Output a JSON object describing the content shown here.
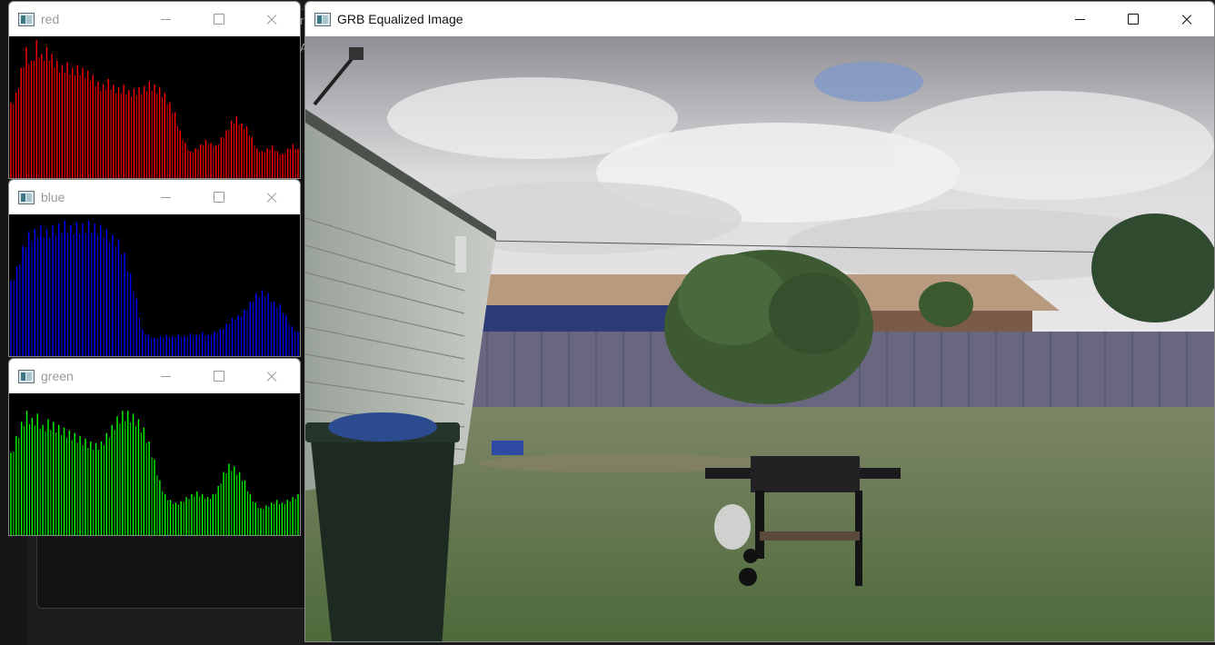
{
  "background": {
    "fragment_1": "r",
    "fragment_2": "A"
  },
  "windows": {
    "red": {
      "title": "red",
      "icon": "opencv-window-icon",
      "color": "#ff0000"
    },
    "blue": {
      "title": "blue",
      "icon": "opencv-window-icon",
      "color": "#0000ff"
    },
    "green": {
      "title": "green",
      "icon": "opencv-window-icon",
      "color": "#00ff00"
    },
    "main": {
      "title": "GRB Equalized Image",
      "icon": "opencv-window-icon"
    }
  },
  "histograms": {
    "red": [
      0.55,
      0.62,
      0.8,
      0.95,
      0.85,
      1.0,
      0.9,
      0.95,
      0.9,
      0.85,
      0.82,
      0.84,
      0.8,
      0.82,
      0.8,
      0.78,
      0.75,
      0.7,
      0.68,
      0.72,
      0.68,
      0.66,
      0.68,
      0.64,
      0.65,
      0.66,
      0.67,
      0.7,
      0.68,
      0.66,
      0.62,
      0.55,
      0.48,
      0.35,
      0.26,
      0.2,
      0.22,
      0.25,
      0.28,
      0.26,
      0.24,
      0.3,
      0.35,
      0.42,
      0.45,
      0.4,
      0.38,
      0.3,
      0.22,
      0.2,
      0.22,
      0.24,
      0.2,
      0.18,
      0.22,
      0.25,
      0.22
    ],
    "blue": [
      0.55,
      0.65,
      0.8,
      0.9,
      0.92,
      0.95,
      0.92,
      0.95,
      0.96,
      0.98,
      0.95,
      0.97,
      0.96,
      0.98,
      0.96,
      0.95,
      0.92,
      0.88,
      0.85,
      0.75,
      0.6,
      0.42,
      0.2,
      0.16,
      0.14,
      0.15,
      0.16,
      0.15,
      0.16,
      0.15,
      0.17,
      0.16,
      0.18,
      0.16,
      0.18,
      0.2,
      0.24,
      0.28,
      0.3,
      0.34,
      0.4,
      0.46,
      0.48,
      0.46,
      0.4,
      0.38,
      0.3,
      0.22,
      0.18
    ],
    "green": [
      0.6,
      0.72,
      0.82,
      0.9,
      0.85,
      0.88,
      0.8,
      0.84,
      0.82,
      0.8,
      0.78,
      0.76,
      0.74,
      0.72,
      0.7,
      0.68,
      0.67,
      0.68,
      0.74,
      0.8,
      0.86,
      0.9,
      0.9,
      0.88,
      0.84,
      0.78,
      0.68,
      0.55,
      0.4,
      0.3,
      0.26,
      0.24,
      0.25,
      0.28,
      0.3,
      0.32,
      0.3,
      0.28,
      0.3,
      0.36,
      0.46,
      0.52,
      0.5,
      0.46,
      0.4,
      0.3,
      0.24,
      0.2,
      0.22,
      0.24,
      0.26,
      0.24,
      0.26,
      0.28,
      0.3
    ]
  }
}
